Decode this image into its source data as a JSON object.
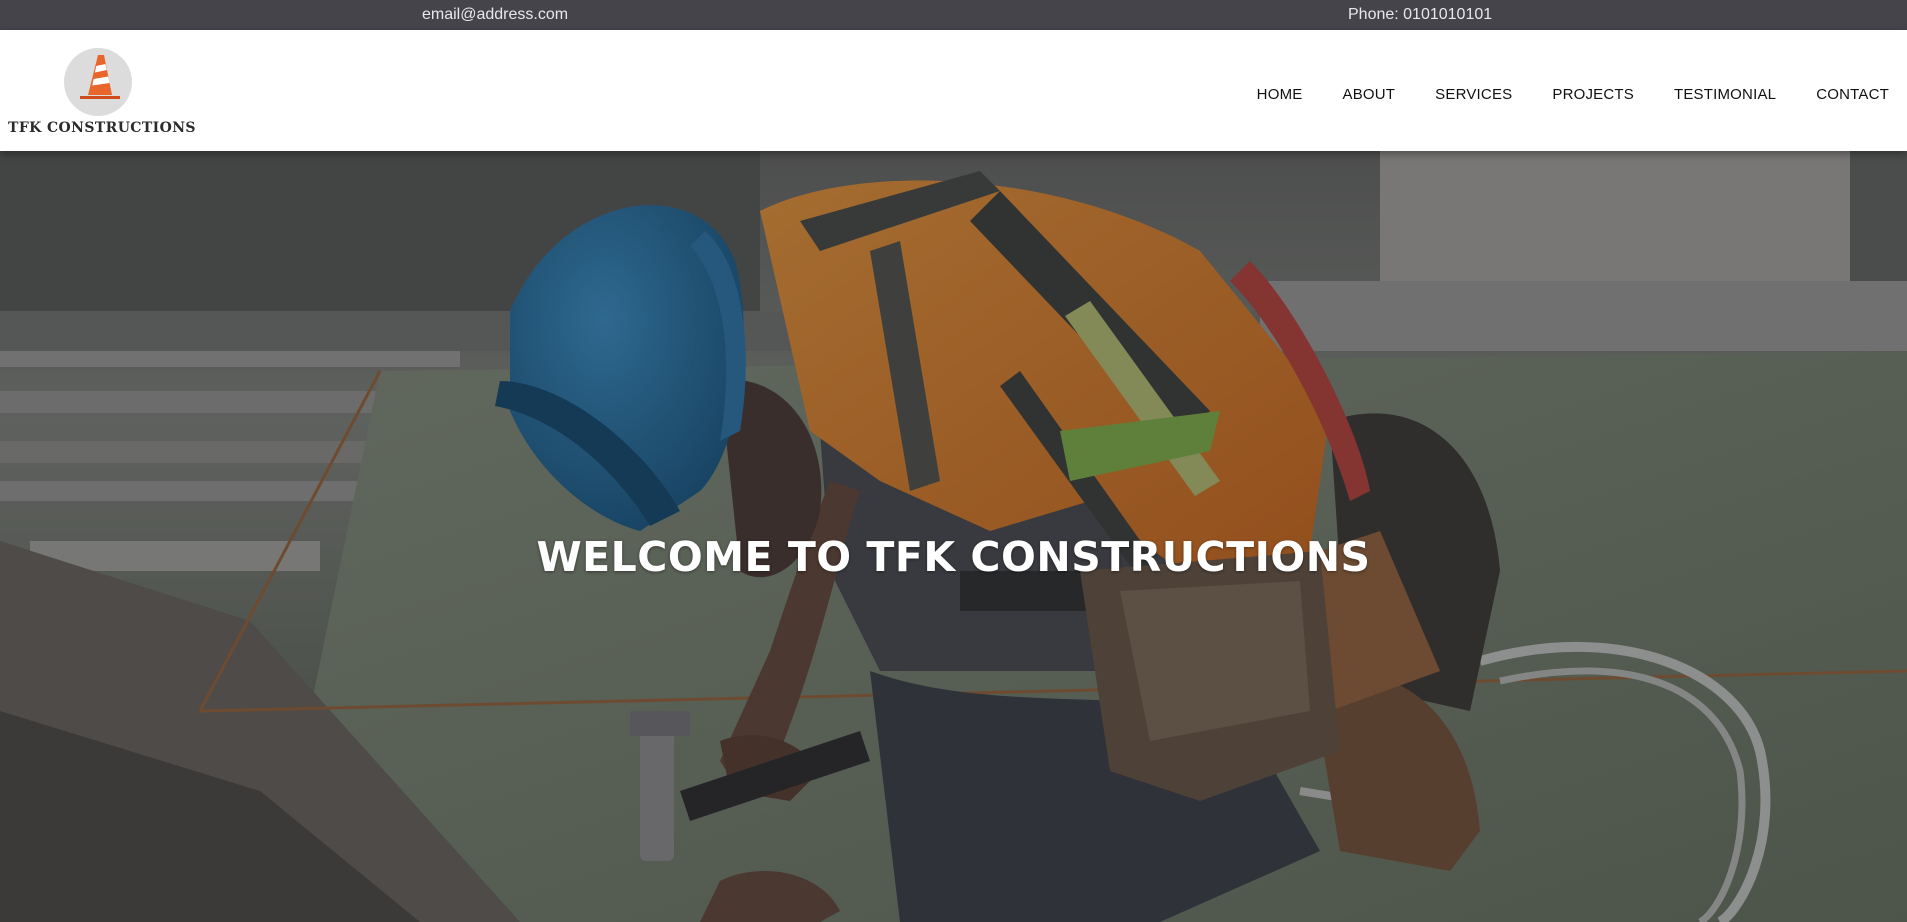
{
  "topbar": {
    "email": "email@address.com",
    "phone": "Phone: 0101010101"
  },
  "brand": {
    "name": "TFK CONSTRUCTIONS",
    "logo_icon": "traffic-cone-icon",
    "colors": {
      "cone": "#e8662c",
      "badge": "#dcdcdc"
    }
  },
  "nav": {
    "items": [
      {
        "label": "HOME"
      },
      {
        "label": "ABOUT"
      },
      {
        "label": "SERVICES"
      },
      {
        "label": "PROJECTS"
      },
      {
        "label": "TESTIMONIAL"
      },
      {
        "label": "CONTACT"
      }
    ]
  },
  "hero": {
    "title": "WELCOME TO TFK CONSTRUCTIONS",
    "image": "construction-worker-photo"
  },
  "colors": {
    "topbar_bg": "#45444b",
    "header_bg": "#ffffff",
    "hero_text": "#ffffff"
  }
}
